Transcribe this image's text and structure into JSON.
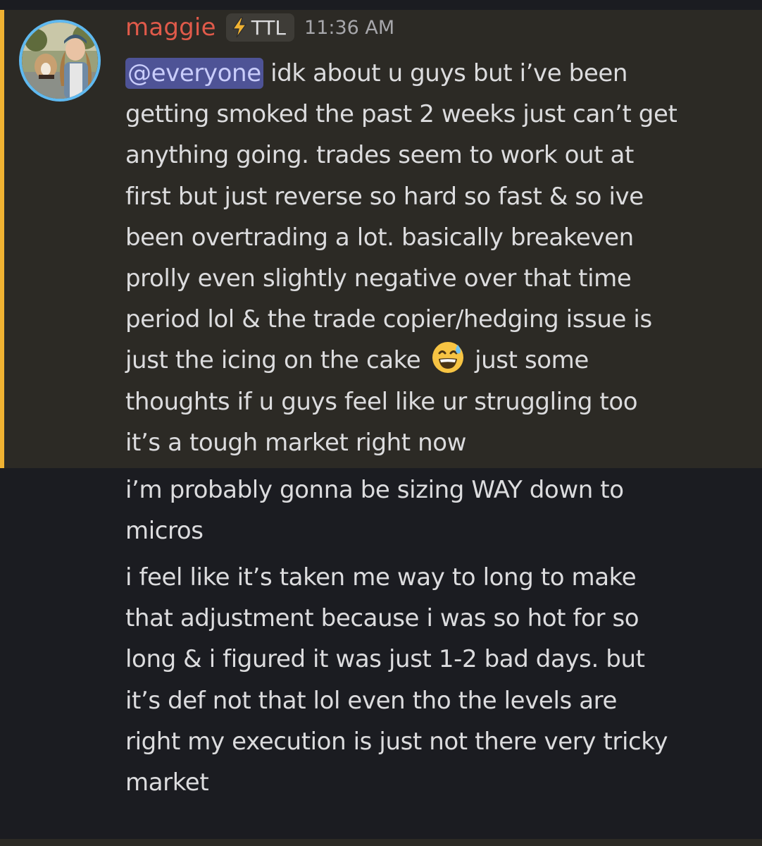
{
  "message_group": {
    "username": "maggie",
    "username_color": "#e05a4a",
    "role_tag": "TTL",
    "role_icon": "lightning-bolt-icon",
    "timestamp": "11:36 AM",
    "avatar": "user-avatar-with-dog",
    "highlight_color": "#f0b232",
    "mention_color": "#4e5396"
  },
  "messages": [
    {
      "mention": "@everyone",
      "text_part1": " idk about u guys but i’ve been\ngetting smoked the past 2 weeks just can’t get\nanything going.  trades seem to work out at\nfirst but just reverse so hard so fast & so ive\nbeen overtrading a lot. basically breakeven\nprolly even slightly negative over that time\nperiod lol & the trade copier/hedging issue is\njust the icing on the cake",
      "emoji": "grinning-face-with-sweat-emoji",
      "text_part2": "just some\nthoughts if u guys feel like ur struggling too\nit’s a tough market right now"
    },
    {
      "text": "i’m probably gonna be sizing WAY down to\nmicros"
    },
    {
      "text": "i feel like it’s taken me way to long to make\nthat adjustment because i was so hot for so\nlong & i figured it was just 1-2 bad days. but\nit’s def not that lol even tho the levels are\nright my execution is just not there very tricky\nmarket"
    }
  ]
}
